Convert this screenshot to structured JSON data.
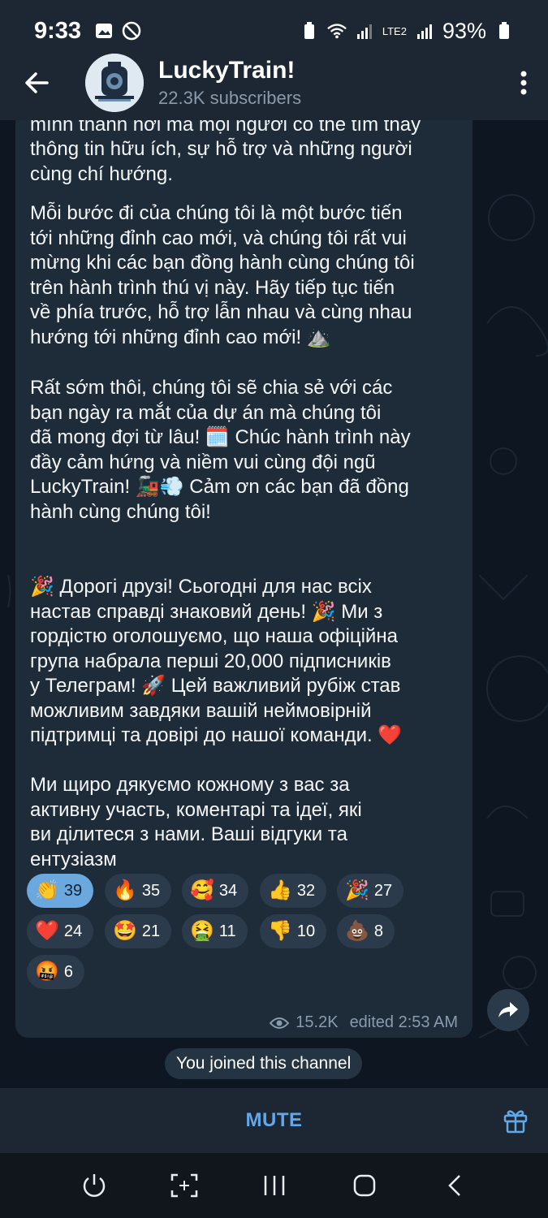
{
  "status_bar": {
    "time": "9:33",
    "battery": "93%",
    "network": "LTE2"
  },
  "header": {
    "title": "LuckyTrain!",
    "subtitle": "22.3K subscribers"
  },
  "message": {
    "paragraphs": [
      "tới đang nỗ lực hết mình để biến nhóm của\nmình thành nơi mà mọi người có thể tìm thấy\nthông tin hữu ích, sự hỗ trợ và những người\ncùng chí hướng.",
      "Mỗi bước đi của chúng tôi là một bước tiến\ntới những đỉnh cao mới, và chúng tôi rất vui\nmừng khi các bạn đồng hành cùng chúng tôi\ntrên hành trình thú vị này. Hãy tiếp tục tiến\nvề phía trước, hỗ trợ lẫn nhau và cùng nhau\nhướng tới những đỉnh cao mới! ⛰️",
      "Rất sớm thôi, chúng tôi sẽ chia sẻ với các\nbạn ngày ra mắt của dự án mà chúng tôi\nđã mong đợi từ lâu! 🗓️ Chúc hành trình này\nđầy cảm hứng và niềm vui cùng đội ngũ\nLuckyTrain! 🚂💨 Cảm ơn các bạn đã đồng\nhành cùng chúng tôi!",
      "🎉 Дорогі друзі! Сьогодні для нас всіх\nнастав справді знаковий день! 🎉 Ми з\nгордістю оголошуємо, що наша офіційна\nгрупа набрала перші 20,000 підписників\nу Телеграм! 🚀 Цей важливий рубіж став\nможливим завдяки вашій неймовірній\nпідтримці та довірі до нашої команди. ❤️",
      "Ми щиро дякуємо кожному з вас за\nактивну участь, коментарі та ідеї, які\nви ділитеся з нами. Ваші відгуки та\nентузіазм"
    ],
    "reactions": [
      {
        "emoji": "👏",
        "count": "39",
        "active": true
      },
      {
        "emoji": "🔥",
        "count": "35",
        "active": false
      },
      {
        "emoji": "🥰",
        "count": "34",
        "active": false
      },
      {
        "emoji": "👍",
        "count": "32",
        "active": false
      },
      {
        "emoji": "🎉",
        "count": "27",
        "active": false
      },
      {
        "emoji": "❤️",
        "count": "24",
        "active": false
      },
      {
        "emoji": "🤩",
        "count": "21",
        "active": false
      },
      {
        "emoji": "🤮",
        "count": "11",
        "active": false
      },
      {
        "emoji": "👎",
        "count": "10",
        "active": false
      },
      {
        "emoji": "💩",
        "count": "8",
        "active": false
      },
      {
        "emoji": "🤬",
        "count": "6",
        "active": false
      }
    ],
    "views": "15.2K",
    "edited": "edited 2:53 AM"
  },
  "system_message": "You joined this channel",
  "bottom_bar": {
    "mute_label": "MUTE"
  },
  "colors": {
    "accent": "#62a8e8",
    "bubble": "#1e2c3a",
    "header": "#1d2733",
    "chat_bg": "#0e1621",
    "active_reaction": "#6aa8de"
  }
}
